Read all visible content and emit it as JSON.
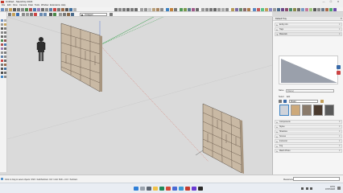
{
  "window": {
    "title": "Untitled - SketchUp 2023",
    "controls": [
      "—",
      "☐",
      "✕"
    ]
  },
  "menubar": {
    "items": [
      "File",
      "Edit",
      "View",
      "Camera",
      "Draw",
      "Tools",
      "Window",
      "Extensions",
      "Help"
    ]
  },
  "toolbar": {
    "layer_value": "Untagged"
  },
  "tray": {
    "title": "Default Tray",
    "close_glyph": "✕",
    "sections_top": [
      "Entity Info",
      "Tags",
      "Materials"
    ],
    "material_name": "[Name]",
    "select_tab": "Select",
    "edit_tab": "Edit",
    "library": "Model",
    "sections_bottom": [
      "Components",
      "Styles",
      "Shadows",
      "Scenes",
      "Instructor",
      "Fog",
      "Match Photo"
    ]
  },
  "status": {
    "message": "Click or drag to select objects. Shift = Add/Subtract. Ctrl = Add. Shift + Ctrl = Subtract.",
    "measurements_label": "Measurements",
    "measurements_value": ""
  },
  "taskbar": {
    "time": "18:51",
    "date": "07/07/2023"
  },
  "colors": {
    "viewport_bg": "#dadada",
    "shelf_face": "#c9b9a4",
    "shelf_dark": "#6e5f51",
    "shelf_side": "#a7957f",
    "axis_green": "#2f9e44",
    "axis_red": "#d44a3a",
    "axis_blue": "#3a5fd4",
    "accent": "#3b82c4"
  }
}
